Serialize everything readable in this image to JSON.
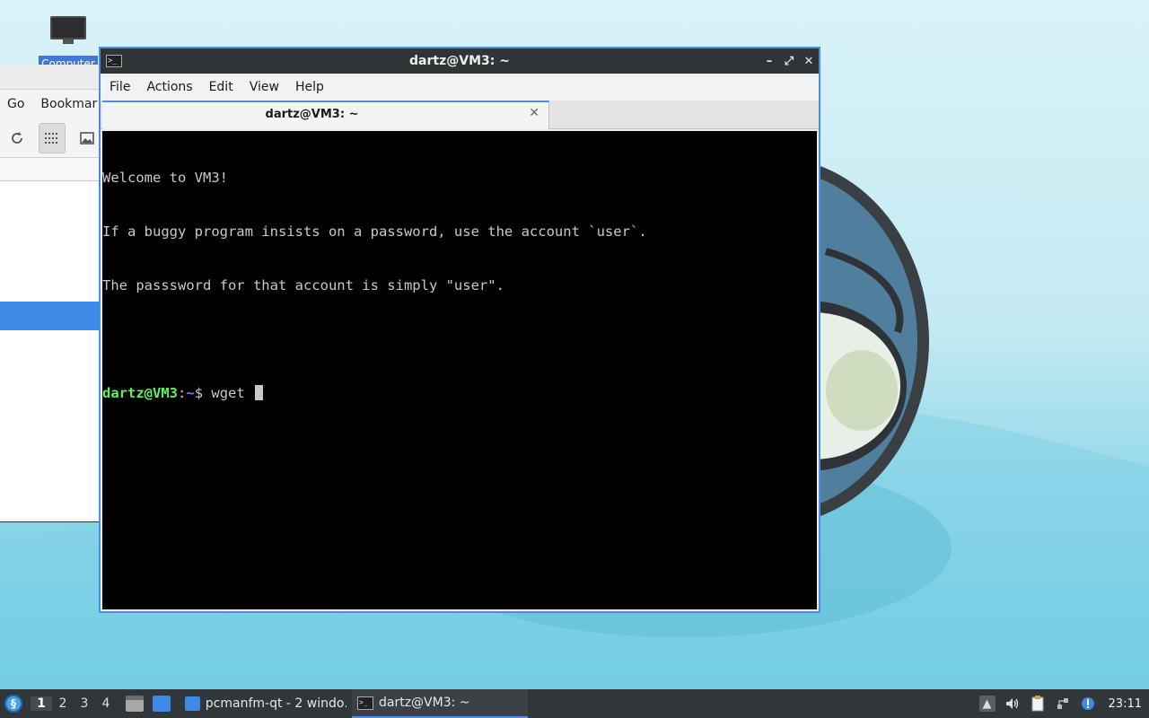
{
  "desktop": {
    "icon_label": "Computer"
  },
  "file_manager": {
    "menu": [
      "Go",
      "Bookmar"
    ],
    "toolbar": [
      "reload-icon",
      "grid-view-icon",
      "thumbnail-view-icon"
    ]
  },
  "terminal": {
    "window_title": "dartz@VM3: ~",
    "menu": [
      "File",
      "Actions",
      "Edit",
      "View",
      "Help"
    ],
    "tab_label": "dartz@VM3: ~",
    "output_lines": [
      "Welcome to VM3!",
      "If a buggy program insists on a password, use the account `user`.",
      "The passsword for that account is simply \"user\".",
      ""
    ],
    "prompt_user": "dartz@VM3",
    "prompt_sep": ":",
    "prompt_path": "~",
    "prompt_symbol": "$ ",
    "command": "wget "
  },
  "taskbar": {
    "desktops": [
      "1",
      "2",
      "3",
      "4"
    ],
    "active_desktop": "1",
    "tasks": [
      {
        "label": "pcmanfm-qt - 2 windo…"
      },
      {
        "label": "dartz@VM3: ~"
      }
    ],
    "clock": "23:11"
  },
  "colors": {
    "accent": "#4a90e2",
    "terminal_bg": "#000000",
    "prompt_user": "#5ef35e",
    "prompt_path": "#6a7dff",
    "taskbar_bg": "#31363b"
  }
}
